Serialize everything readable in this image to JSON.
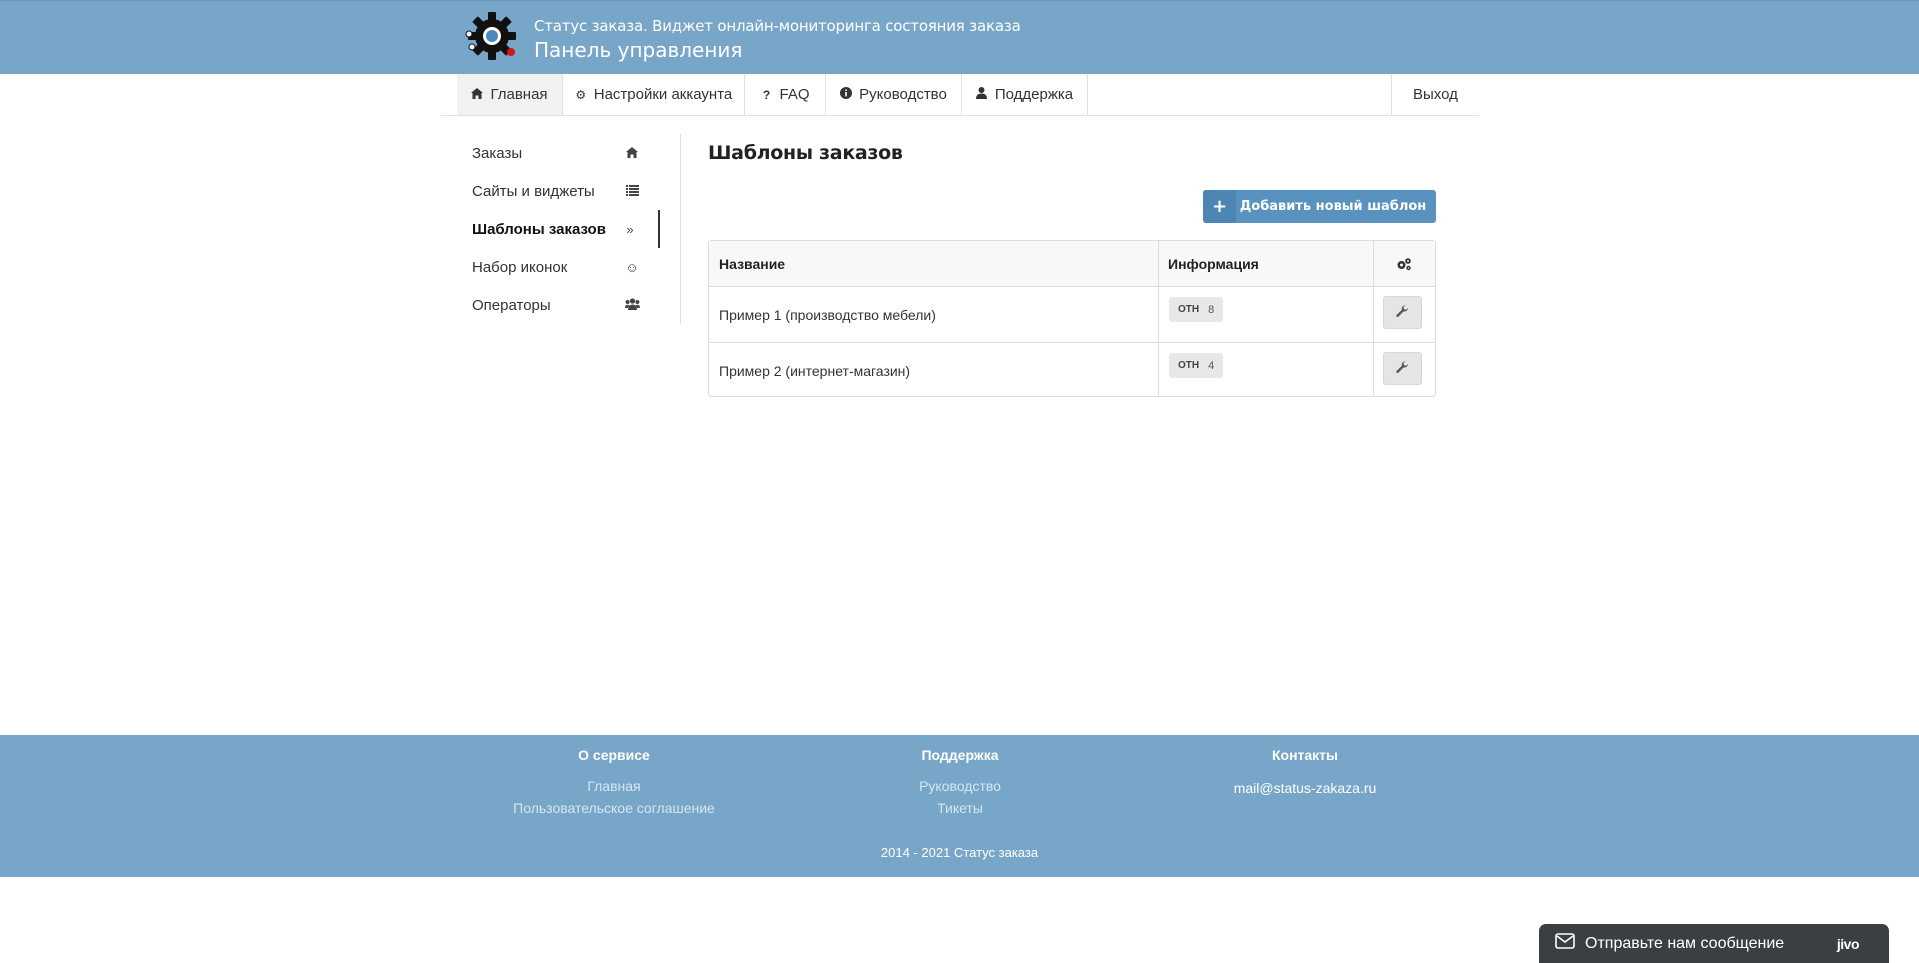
{
  "header": {
    "subtitle": "Статус заказа. Виджет онлайн-мониторинга состояния заказа",
    "title": "Панель управления",
    "logo_icon": "gear-logo-icon"
  },
  "nav": {
    "items": [
      {
        "label": "Главная",
        "icon": "home-icon"
      },
      {
        "label": "Настройки аккаунта",
        "icon": "gear-icon"
      },
      {
        "label": "FAQ",
        "icon": "question-icon"
      },
      {
        "label": "Руководство",
        "icon": "info-icon"
      },
      {
        "label": "Поддержка",
        "icon": "user-icon"
      }
    ],
    "exit": "Выход"
  },
  "sidebar": {
    "items": [
      {
        "label": "Заказы",
        "icon": "home-icon"
      },
      {
        "label": "Сайты и виджеты",
        "icon": "list-icon"
      },
      {
        "label": "Шаблоны заказов",
        "icon": "double-chevron-right-icon"
      },
      {
        "label": "Набор иконок",
        "icon": "smile-icon"
      },
      {
        "label": "Операторы",
        "icon": "users-icon"
      }
    ],
    "active_index": 2
  },
  "main": {
    "title": "Шаблоны заказов",
    "add_button": "Добавить новый шаблон",
    "table": {
      "headers": [
        "Название",
        "Информация"
      ],
      "settings_icon": "gears-icon",
      "rows": [
        {
          "name": "Пример 1 (производство мебели)",
          "badge_label": "ОТН",
          "badge_value": "8"
        },
        {
          "name": "Пример 2 (интернет-магазин)",
          "badge_label": "ОТН",
          "badge_value": "4"
        }
      ]
    }
  },
  "footer": {
    "col1": {
      "title": "О сервисе",
      "links": [
        "Главная",
        "Пользовательское соглашение"
      ]
    },
    "col2": {
      "title": "Поддержка",
      "links": [
        "Руководство",
        "Тикеты"
      ]
    },
    "col3": {
      "title": "Контакты",
      "email": "mail@status-zakaza.ru"
    },
    "copyright": "2014 - 2021 Статус заказа"
  },
  "chat": {
    "label": "Отправьте нам сообщение",
    "brand": "jivo"
  },
  "colors": {
    "header_bg": "#78a6c9",
    "button_bg": "#5a92bf",
    "chat_bg": "#3a3f44"
  }
}
